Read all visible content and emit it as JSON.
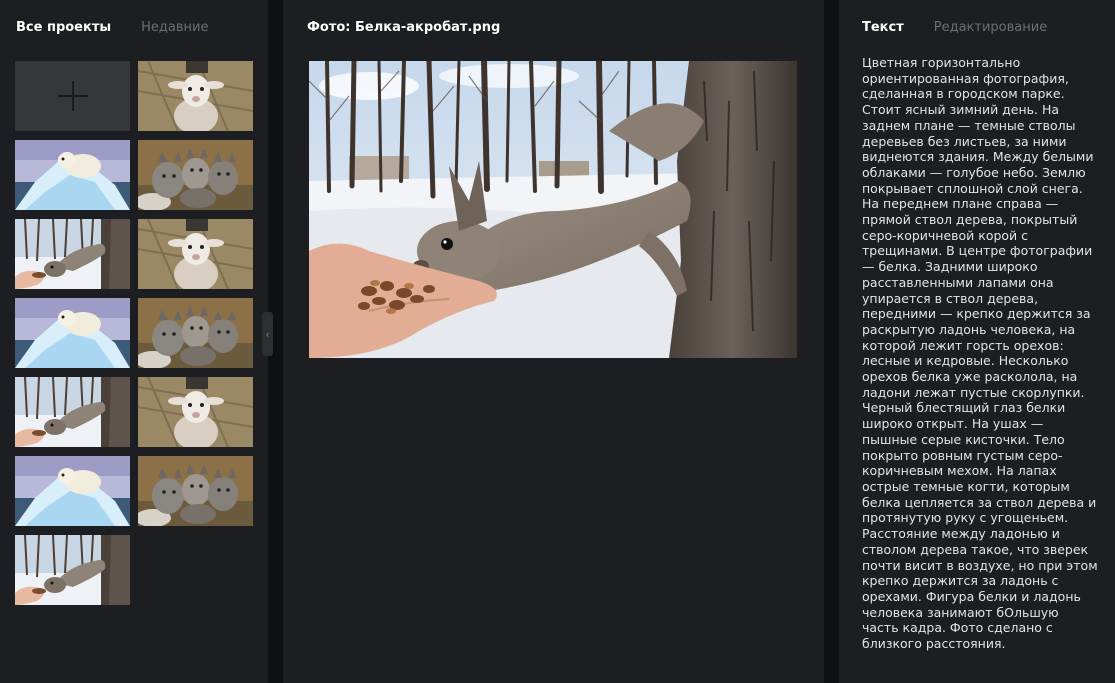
{
  "left_panel": {
    "tabs": [
      {
        "label": "Все проекты",
        "active": true
      },
      {
        "label": "Недавние",
        "active": false
      }
    ],
    "thumbnails": [
      {
        "type": "add-new",
        "icon": "plus-icon"
      },
      {
        "subject": "lamb"
      },
      {
        "subject": "polar-bear"
      },
      {
        "subject": "kittens"
      },
      {
        "subject": "squirrel"
      },
      {
        "subject": "lamb"
      },
      {
        "subject": "polar-bear"
      },
      {
        "subject": "kittens"
      },
      {
        "subject": "squirrel"
      },
      {
        "subject": "lamb"
      },
      {
        "subject": "polar-bear"
      },
      {
        "subject": "kittens"
      },
      {
        "subject": "squirrel"
      }
    ]
  },
  "center_panel": {
    "title": "Фото: Белка-акробат.png"
  },
  "right_panel": {
    "tabs": [
      {
        "label": "Текст",
        "active": true
      },
      {
        "label": "Редактирование",
        "active": false
      }
    ],
    "description": "Цветная горизонтально\nориентированная фотография,\nсделанная в городском  парке.\nСтоит ясный зимний день. На\nзаднем плане — темные стволы\nдеревьев  без листьев, за ними\nвиднеются здания. Между белыми\nоблаками — голубое  небо. Землю\nпокрывает сплошной слой снега.\n На переднем плане справа —\nпрямой ствол дерева, покрытый\nсеро-коричневой  корой с\nтрещинами. В центре фотографии\n— белка. Задними широко\nрасставленными лапами она\nупирается в ствол дерева,\nпередними — крепко  держится за\nраскрытую ладонь человека, на\nкоторой лежит горсть орехов:\nлесные и кедровые. Несколько\nорехов белка уже расколола, на\nладони лежат  пустые скорлупки.\nЧерный блестящий глаз белки\nшироко открыт. На ушах —\nпышные серые кисточки. Тело\nпокрыто ровным густым серо-\nкоричневым мехом.  На лапах\nострые темные когти, которым\nбелка цепляется за ствол дерева и\nпротянутую руку с угощеньем.\nРасстояние между ладонью и\nстволом дерева  такое, что зверек\nпочти висит в воздухе, но при этом\nкрепко держится за  ладонь с\nорехами. Фигура белки и ладонь\nчеловека занимают бОльшую\nчасть  кадра. Фото сделано с\nблизкого расстояния."
  },
  "colors": {
    "background": "#0e1013",
    "panel": "#1c1e21",
    "text_active": "#ffffff",
    "text_inactive": "#6d6f73"
  }
}
